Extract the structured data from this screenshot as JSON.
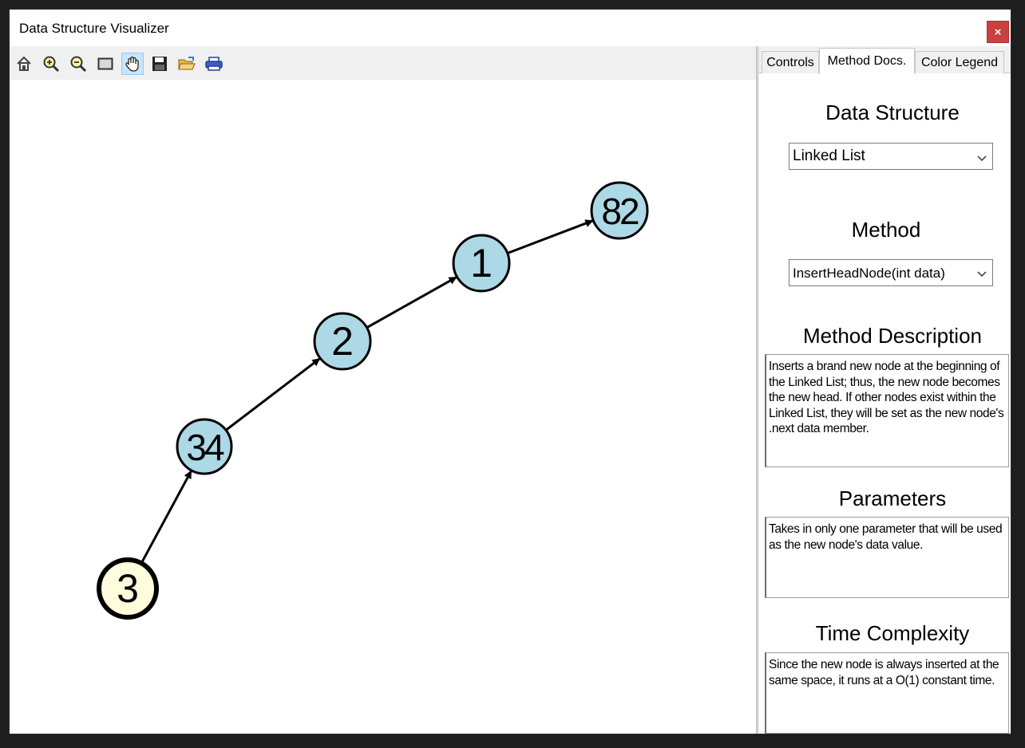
{
  "window": {
    "title": "Data Structure Visualizer",
    "close_glyph": "×"
  },
  "toolbar": {
    "icons": [
      "home-icon",
      "zoom-in-icon",
      "zoom-out-icon",
      "zoom-rectangle-icon",
      "pan-hand-icon",
      "save-icon",
      "open-folder-icon",
      "print-icon"
    ],
    "active": "pan-hand-icon"
  },
  "graph": {
    "nodes": [
      {
        "label": "3",
        "role": "head",
        "fill": "#fffcdd"
      },
      {
        "label": "34",
        "fill": "#add8e6"
      },
      {
        "label": "2",
        "fill": "#add8e6"
      },
      {
        "label": "1",
        "fill": "#add8e6"
      },
      {
        "label": "82",
        "fill": "#add8e6"
      }
    ],
    "edges": [
      [
        "3",
        "34"
      ],
      [
        "34",
        "2"
      ],
      [
        "2",
        "1"
      ],
      [
        "1",
        "82"
      ]
    ]
  },
  "panel": {
    "tabs": [
      {
        "label": "Controls",
        "active": false
      },
      {
        "label": "Method Docs.",
        "active": true
      },
      {
        "label": "Color Legend",
        "active": false
      }
    ],
    "data_structure": {
      "title": "Data Structure",
      "value": "Linked List"
    },
    "method": {
      "title": "Method",
      "value": "InsertHeadNode(int data)"
    },
    "description": {
      "title": "Method Description",
      "text": "Inserts a brand new node at the beginning of the Linked List; thus, the new node becomes the new head. If other nodes exist within the Linked List, they will be set as the new node's .next data member."
    },
    "parameters": {
      "title": "Parameters",
      "text": "Takes in only one parameter that will be used as the new node's data value."
    },
    "complexity": {
      "title": "Time Complexity",
      "text": "Since the new node is always inserted at the same space, it runs at a O(1) constant time."
    }
  }
}
